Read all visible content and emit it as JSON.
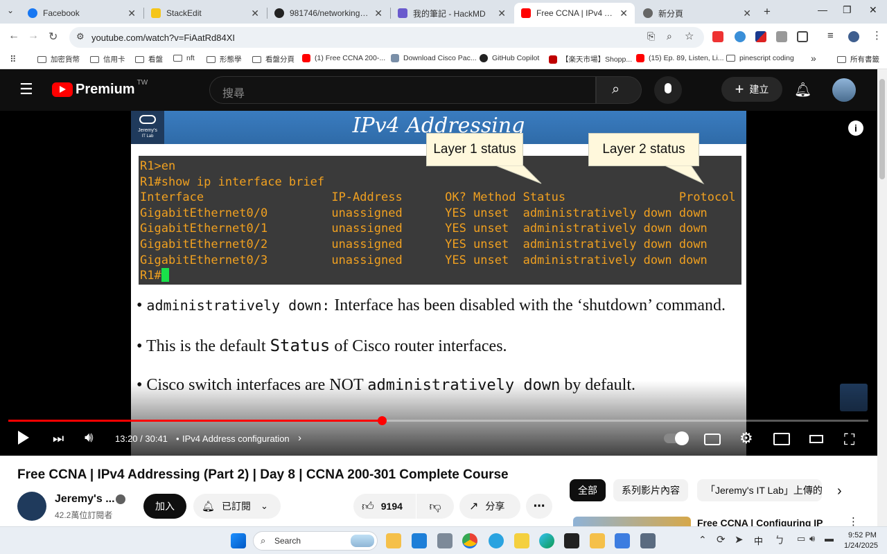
{
  "browser": {
    "tabs": [
      {
        "label": "Facebook",
        "icon": "facebook-icon",
        "color": "#1877f2",
        "active": false
      },
      {
        "label": "StackEdit",
        "icon": "stackedit-icon",
        "color": "#f5c518",
        "active": false
      },
      {
        "label": "981746/networking-funda",
        "icon": "github-icon",
        "color": "#222222",
        "active": false
      },
      {
        "label": "我的筆記 - HackMD",
        "icon": "hackmd-icon",
        "color": "#6a5acd",
        "active": false
      },
      {
        "label": "Free CCNA | IPv4 Addressin",
        "icon": "youtube-icon",
        "color": "#ff0000",
        "active": true
      },
      {
        "label": "新分頁",
        "icon": "chrome-icon",
        "color": "#555555",
        "active": false
      }
    ],
    "url": "youtube.com/watch?v=FiAatRd84XI",
    "bookmarks": [
      {
        "label": "加密貨幣",
        "type": "folder"
      },
      {
        "label": "信用卡",
        "type": "folder"
      },
      {
        "label": "看盤",
        "type": "folder"
      },
      {
        "label": "nft",
        "type": "folder"
      },
      {
        "label": "形態學",
        "type": "folder"
      },
      {
        "label": "看盤分頁",
        "type": "folder"
      },
      {
        "label": "(1) Free CCNA 200-...",
        "type": "youtube"
      },
      {
        "label": "Download Cisco Pac...",
        "type": "site"
      },
      {
        "label": "GitHub Copilot",
        "type": "github"
      },
      {
        "label": "【楽天市場】Shopp...",
        "type": "rakuten"
      },
      {
        "label": "(15) Ep. 89, Listen, Li...",
        "type": "youtube"
      },
      {
        "label": "pinescript coding",
        "type": "folder"
      }
    ],
    "bookmarks_more": "»",
    "all_bookmarks": "所有書籤"
  },
  "youtube": {
    "logo_text": "Premium",
    "logo_region": "TW",
    "search_placeholder": "搜尋",
    "create_label": "建立",
    "slide": {
      "title": "IPv4 Addressing",
      "logo_line1": "Jeremy's",
      "logo_line2": "IT Lab",
      "callout1": "Layer 1 status",
      "callout2": "Layer 2 status",
      "terminal_lines": [
        "R1>en",
        "R1#show ip interface brief",
        "Interface                  IP-Address      OK? Method Status                Protocol",
        "GigabitEthernet0/0         unassigned      YES unset  administratively down down",
        "GigabitEthernet0/1         unassigned      YES unset  administratively down down",
        "GigabitEthernet0/2         unassigned      YES unset  administratively down down",
        "GigabitEthernet0/3         unassigned      YES unset  administratively down down"
      ],
      "terminal_prompt": "R1#",
      "bullet1_mono": "administratively down:",
      "bullet1_text": " Interface has been disabled with the ‘shutdown’ command.",
      "bullet2_a": "This is the default ",
      "bullet2_mono": "Status",
      "bullet2_b": " of Cisco router interfaces.",
      "bullet3_a": "Cisco switch interfaces are NOT ",
      "bullet3_mono": "administratively down",
      "bullet3_b": " by default."
    },
    "player": {
      "time": "13:20 / 30:41",
      "chapter": "IPv4 Address configuration",
      "progress": 0.434
    },
    "video_title": "Free CCNA | IPv4 Addressing (Part 2) | Day 8 | CCNA 200-301 Complete Course",
    "channel": {
      "name": "Jeremy's ...",
      "subscribers": "42.2萬位訂閱者",
      "join_label": "加入",
      "subscribed_label": "已訂閱"
    },
    "likes": "9194",
    "share_label": "分享",
    "chips": [
      "全部",
      "系列影片內容",
      "「Jeremy's IT Lab」上傳的"
    ],
    "next_video_title": "Free CCNA | Configuring IP"
  },
  "taskbar": {
    "search_label": "Search",
    "time": "9:52 PM",
    "date": "1/24/2025",
    "ime": "中"
  }
}
